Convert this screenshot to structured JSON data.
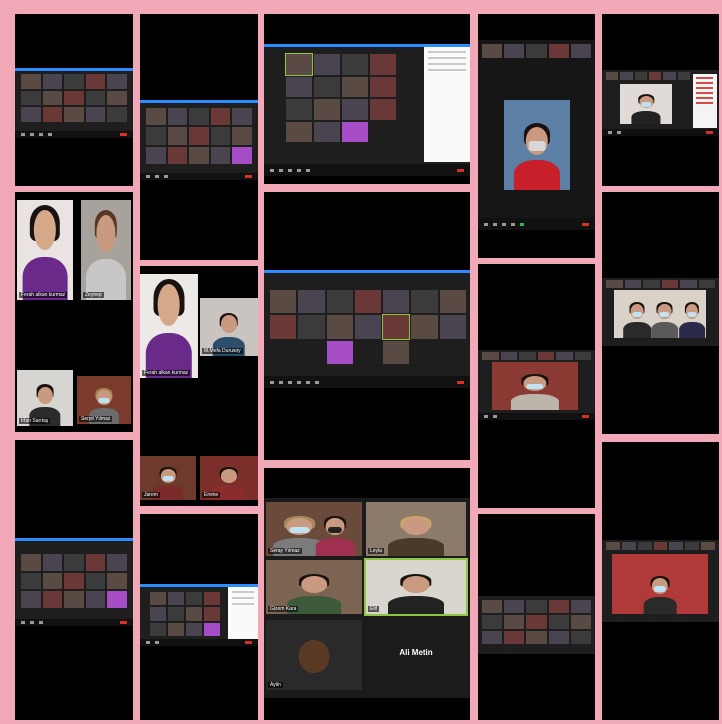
{
  "collage": {
    "labels": {
      "p1_label": "Ferah alkan kurmaz",
      "p1_label2": "Zeynep",
      "p1_label3": "Irfan Sarıtaş",
      "p1_label4": "Serpil Yılmaz",
      "p2_big": "Ferah alkan kurmaz",
      "p2_big2": "M.Mefa Durusoy",
      "p2_small1": "Jarem",
      "p2_small2": "Emine",
      "bottom_tl": "Seray Yılmaz",
      "bottom_tr": "Leyla",
      "bottom_ml": "Gizem Kara",
      "bottom_mr": "Elif",
      "bottom_bl": "Aylin",
      "bottom_center_name": "Ali Metin"
    }
  }
}
